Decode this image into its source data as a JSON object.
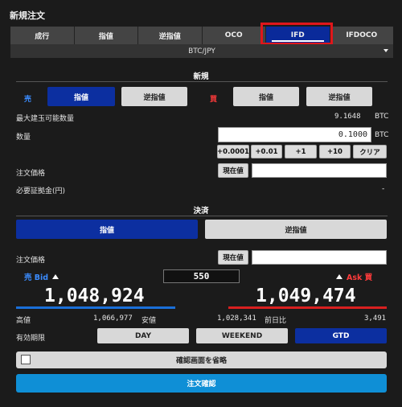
{
  "title": "新規注文",
  "tabs": [
    "成行",
    "指値",
    "逆指値",
    "OCO",
    "IFD",
    "IFDOCO"
  ],
  "active_tab": "IFD",
  "pair": "BTC/JPY",
  "new_section": {
    "heading": "新規",
    "sell_label": "売",
    "buy_label": "買",
    "sell_limit": "指値",
    "sell_stop": "逆指値",
    "buy_limit": "指値",
    "buy_stop": "逆指値",
    "max_qty_label": "最大建玉可能数量",
    "max_qty_value": "9.1648",
    "max_qty_unit": "BTC",
    "qty_label": "数量",
    "qty_value": "0.1000",
    "qty_unit": "BTC",
    "qty_buttons": [
      "+0.0001",
      "+0.01",
      "+1",
      "+10"
    ],
    "clear_label": "クリア",
    "order_price_label": "注文価格",
    "current_price_btn": "現在値",
    "margin_label": "必要証拠金(円)",
    "margin_value": "-"
  },
  "settle_section": {
    "heading": "決済",
    "limit": "指値",
    "stop": "逆指値",
    "order_price_label": "注文価格",
    "current_price_btn": "現在値"
  },
  "prices": {
    "bid_label": "売 Bid",
    "ask_label": "Ask 買",
    "spread": "550",
    "bid": "1,048,924",
    "ask": "1,049,474",
    "high_label": "高値",
    "high_value": "1,066,977",
    "low_label": "安値",
    "low_value": "1,028,341",
    "change_label": "前日比",
    "change_value": "3,491"
  },
  "expiry": {
    "label": "有効期限",
    "options": [
      "DAY",
      "WEEKEND",
      "GTD"
    ],
    "selected": "GTD"
  },
  "skip_confirm_label": "確認画面を省略",
  "confirm_label": "注文確認",
  "colors": {
    "accent_blue": "#0c2fa0",
    "sell_color": "#3b8cff",
    "buy_color": "#ff3b3b",
    "confirm_blue": "#0f8fd6",
    "highlight_red": "#e0161b"
  }
}
